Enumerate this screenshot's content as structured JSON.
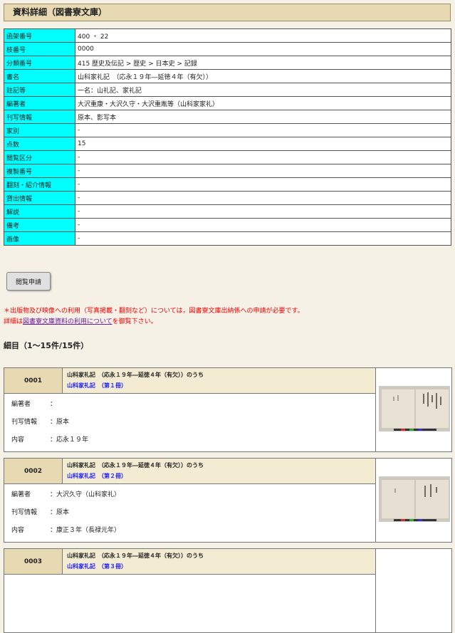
{
  "header": {
    "title": "資料詳細（図書寮文庫）"
  },
  "detail_rows": [
    {
      "label": "函架番号",
      "value": "400 ・ 22"
    },
    {
      "label": "枝番号",
      "value": "0000"
    },
    {
      "label": "分類番号",
      "value": "415 歴史及伝記 > 歴史 > 日本史 > 記録"
    },
    {
      "label": "書名",
      "value": "山科家礼記　（応永１９年―延徳４年（有欠））"
    },
    {
      "label": "註記等",
      "value": "一名：山礼記、家礼記"
    },
    {
      "label": "編著者",
      "value": "大沢重康・大沢久守・大沢重胤等（山科家家礼）"
    },
    {
      "label": "刊写情報",
      "value": "原本、影写本"
    },
    {
      "label": "家別",
      "value": "-"
    },
    {
      "label": "点数",
      "value": "15"
    },
    {
      "label": "閲覧区分",
      "value": "-"
    },
    {
      "label": "複製番号",
      "value": "-"
    },
    {
      "label": "翻刻・紹介情報",
      "value": "-"
    },
    {
      "label": "貸出情報",
      "value": "-"
    },
    {
      "label": "解説",
      "value": "-"
    },
    {
      "label": "備考",
      "value": "-"
    },
    {
      "label": "画像",
      "value": "-"
    }
  ],
  "apply_button": {
    "label": "閲覧申請"
  },
  "notice": {
    "line1": "＊出版物及び映像への利用（写真掲載・翻刻など）については，図書寮文庫出納係への申請が必要です。",
    "line2_prefix": "詳細は",
    "line2_link": "図書寮文庫資料の利用について",
    "line2_suffix": "を御覧下さい。"
  },
  "items_section": {
    "title": "細目（1～15件/15件）"
  },
  "items": [
    {
      "number": "0001",
      "parent_title": "山科家礼記　（応永１９年―延徳４年（有欠））のうち",
      "volume_title": "山科家礼記　（第１冊）",
      "author_label": "編著者",
      "author": "：",
      "publish_label": "刊写情報",
      "publish": "：原本",
      "content_label": "内容",
      "content": "：応永１９年"
    },
    {
      "number": "0002",
      "parent_title": "山科家礼記　（応永１９年―延徳４年（有欠））のうち",
      "volume_title": "山科家礼記　（第２冊）",
      "author_label": "編著者",
      "author": "：大沢久守（山科家礼）",
      "publish_label": "刊写情報",
      "publish": "：原本",
      "content_label": "内容",
      "content": "：康正３年（長禄元年）"
    },
    {
      "number": "0003",
      "parent_title": "山科家礼記　（応永１９年―延徳４年（有欠））のうち",
      "volume_title": "山科家礼記　（第３冊）"
    }
  ]
}
